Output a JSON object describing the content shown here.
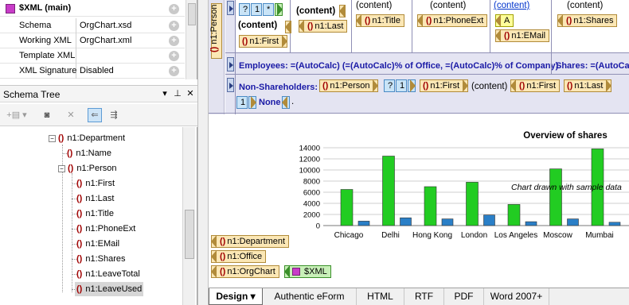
{
  "properties": {
    "header": "$XML (main)",
    "rows": [
      {
        "key": "Schema",
        "value": "OrgChart.xsd"
      },
      {
        "key": "Working XML",
        "value": "OrgChart.xml"
      },
      {
        "key": "Template XML",
        "value": ""
      },
      {
        "key": "XML Signature",
        "value": "Disabled"
      }
    ]
  },
  "schema_tree": {
    "title": "Schema Tree",
    "nodes": [
      {
        "label": "n1:Department"
      },
      {
        "label": "n1:Name"
      },
      {
        "label": "n1:Person"
      },
      {
        "label": "n1:First"
      },
      {
        "label": "n1:Last"
      },
      {
        "label": "n1:Title"
      },
      {
        "label": "n1:PhoneExt"
      },
      {
        "label": "n1:EMail"
      },
      {
        "label": "n1:Shares"
      },
      {
        "label": "n1:LeaveTotal"
      },
      {
        "label": "n1:LeaveUsed"
      }
    ]
  },
  "design": {
    "side_tag": "n1:Person",
    "row1": {
      "q": "?",
      "one": "1",
      "star": "*",
      "content1": "(content)",
      "content2": "(content)",
      "first": "n1:First",
      "content3": "(content)",
      "last": "n1:Last",
      "content4": "(content)",
      "title": "n1:Title",
      "content5": "(content)",
      "phone": "n1:PhoneExt",
      "content6": "(content)",
      "a": "A",
      "email": "n1:EMail",
      "content7": "(content)",
      "shares": "n1:Shares"
    },
    "employees": "Employees:  =(AutoCalc) (=(AutoCalc)% of Office, =(AutoCalc)% of Company)",
    "shares_calc": "Shares: =(AutoCalc",
    "nonshare": {
      "label": "Non-Shareholders:",
      "person": "n1:Person",
      "q": "?",
      "one": "1",
      "first1": "n1:First",
      "content": "(content)",
      "first2": "n1:First",
      "last": "n1:Last",
      "one2": "1",
      "none": "None",
      "dot": "."
    },
    "closing_tags": [
      "n1:Department",
      "n1:Office",
      "n1:OrgChart"
    ],
    "xml_tag": "$XML"
  },
  "chart_data": {
    "type": "bar",
    "title": "Overview of shares",
    "annotation": "Chart drawn with sample data",
    "categories": [
      "Chicago",
      "Delhi",
      "Hong Kong",
      "London",
      "Los Angeles",
      "Moscow",
      "Mumbai"
    ],
    "series": [
      {
        "values": [
          6500,
          12500,
          7000,
          7800,
          3800,
          10200,
          13800
        ],
        "color": "#22cc22"
      },
      {
        "values": [
          800,
          1400,
          1200,
          1900,
          700,
          1200,
          600
        ],
        "color": "#2a7fc7"
      }
    ],
    "ylim": [
      0,
      14000
    ],
    "yticks": [
      "0",
      "2000",
      "4000",
      "6000",
      "8000",
      "10000",
      "12000",
      "14000"
    ],
    "grid": true
  },
  "tabs": [
    "Design",
    "Authentic eForm",
    "HTML",
    "RTF",
    "PDF",
    "Word 2007+"
  ]
}
